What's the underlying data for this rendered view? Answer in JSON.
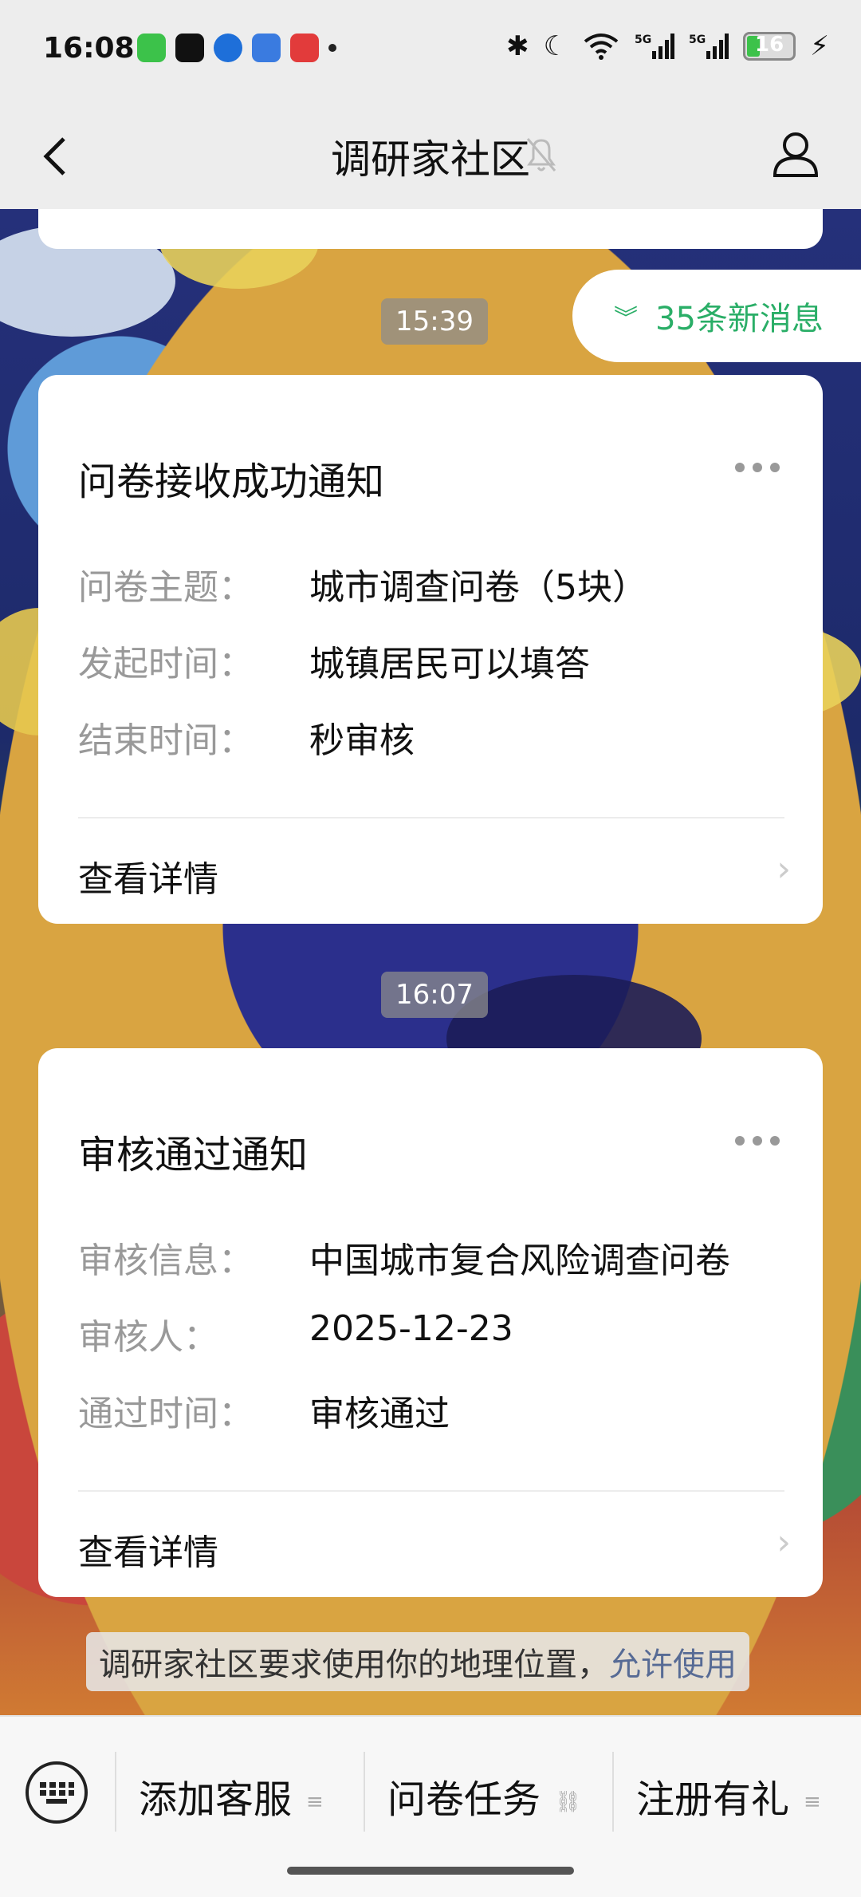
{
  "status_bar": {
    "time": "16:08",
    "battery": "16"
  },
  "nav": {
    "title": "调研家社区"
  },
  "new_messages": "35条新消息",
  "timestamps": [
    "15:39",
    "16:07"
  ],
  "cards": [
    {
      "title": "问卷接收成功通知",
      "rows": [
        {
          "key": "问卷主题：",
          "value": "城市调查问卷（5块）"
        },
        {
          "key": "发起时间：",
          "value": "城镇居民可以填答"
        },
        {
          "key": "结束时间：",
          "value": "秒审核"
        }
      ],
      "detail": "查看详情"
    },
    {
      "title": "审核通过通知",
      "rows": [
        {
          "key": "审核信息：",
          "value": "中国城市复合风险调查问卷"
        },
        {
          "key": "审核人：",
          "value": "2025-12-23"
        },
        {
          "key": "通过时间：",
          "value": "审核通过"
        }
      ],
      "detail": "查看详情"
    }
  ],
  "location_prompt": {
    "text": "调研家社区要求使用你的地理位置，",
    "link": "允许使用"
  },
  "bottom_menu": [
    "添加客服",
    "问卷任务",
    "注册有礼"
  ],
  "colors": {
    "accent_green": "#2aae67",
    "link_blue": "#576b95"
  }
}
